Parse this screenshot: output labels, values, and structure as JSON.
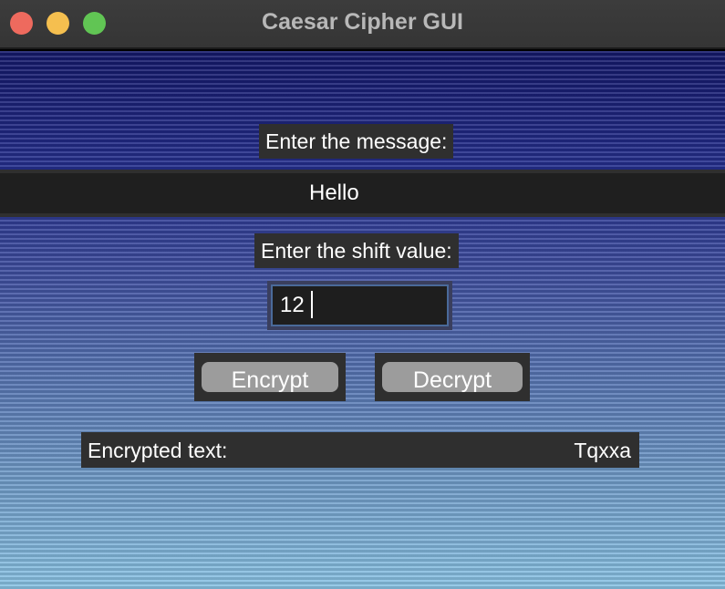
{
  "window": {
    "title": "Caesar Cipher GUI"
  },
  "message": {
    "label": "Enter the message:",
    "value": "Hello"
  },
  "shift": {
    "label": "Enter the shift value:",
    "value": "12"
  },
  "buttons": {
    "encrypt": "Encrypt",
    "decrypt": "Decrypt"
  },
  "result": {
    "label": "Encrypted text:",
    "value": "Tqxxa"
  }
}
